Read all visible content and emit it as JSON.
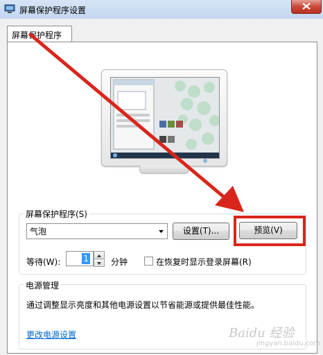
{
  "window": {
    "title": "屏幕保护程序设置"
  },
  "tabs": [
    {
      "label": "屏幕保护程序"
    }
  ],
  "screensaver": {
    "group_label": "屏幕保护程序(S)",
    "selected": "气泡",
    "settings_button": "设置(T)...",
    "preview_button": "预览(V)",
    "wait_label": "等待(W):",
    "wait_value": "1",
    "minute_label": "分钟",
    "resume_checkbox_label": "在恢复时显示登录屏幕(R)",
    "resume_checked": false
  },
  "power": {
    "group_label": "电源管理",
    "description": "通过调整显示亮度和其他电源设置以节省能源或提供最佳性能。",
    "link": "更改电源设置"
  },
  "watermark": {
    "text": "Baidu 经验",
    "sub": "jingyan.baidu.com"
  },
  "colors": {
    "annotation_red": "#d9261c",
    "link_blue": "#0066cc",
    "selection_blue": "#3399ff"
  }
}
